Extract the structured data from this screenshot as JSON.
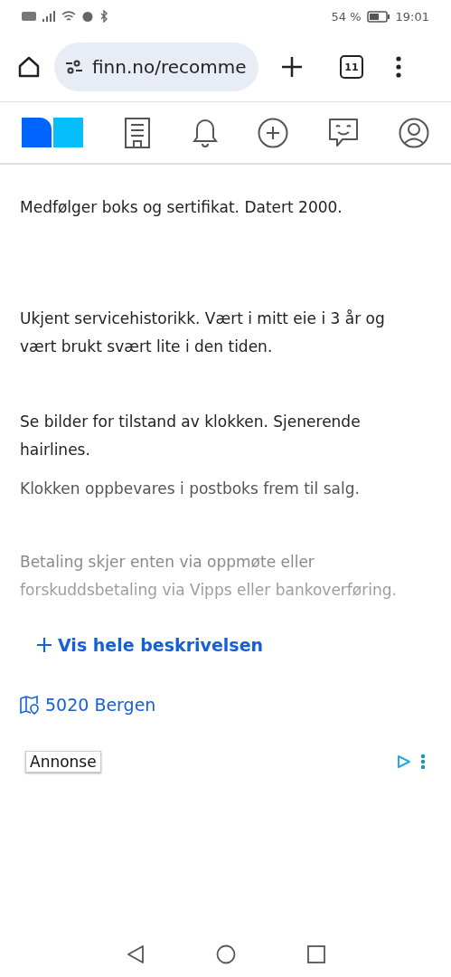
{
  "status_bar": {
    "battery": "54 %",
    "time": "19:01"
  },
  "browser": {
    "url": "finn.no/recomme",
    "tab_count": "11"
  },
  "paragraphs": [
    {
      "text": "Medfølger boks og sertifikat. Datert 2000.",
      "kind": "normal"
    },
    {
      "text": "Ukjent servicehistorikk. Vært i mitt eie i 3 år og vært brukt svært lite i den tiden.",
      "kind": "normal"
    },
    {
      "text": "Se bilder for tilstand av klokken. Sjenerende hairlines.",
      "kind": "normal"
    },
    {
      "text": "Klokken oppbevares i postboks frem til salg.",
      "kind": "muted"
    },
    {
      "text": "Betaling skjer enten via oppmøte eller forskuddsbetaling via Vipps eller bankoverføring.",
      "kind": "faded"
    }
  ],
  "show_more": "Vis hele beskrivelsen",
  "location": "5020 Bergen",
  "ad_label": "Annonse"
}
